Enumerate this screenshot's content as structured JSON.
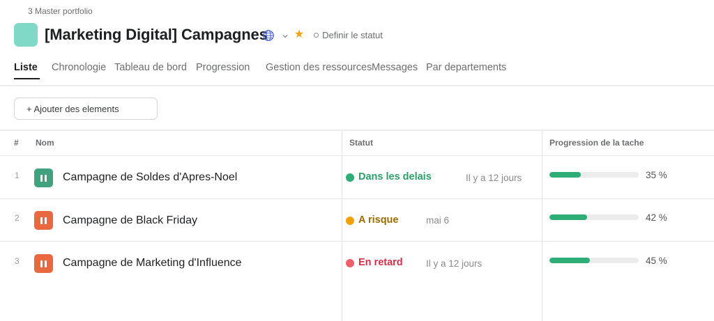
{
  "breadcrumb": "3 Master portfolio",
  "project": {
    "title": "[Marketing Digital] Campagnes",
    "status_prompt": "Definir le statut",
    "color": "#7fd9c6"
  },
  "icons": {
    "globe": "globe-icon",
    "chevron": "chevron-down-icon",
    "star": "star-icon",
    "status_circle": "circle-icon",
    "row_status": "pause-icon"
  },
  "tabs": [
    {
      "label": "Liste",
      "active": true
    },
    {
      "label": "Chronologie",
      "active": false
    },
    {
      "label": "Tableau de bord",
      "active": false
    },
    {
      "label": "Progression",
      "active": false
    },
    {
      "label": "Gestion des ressources",
      "active": false
    },
    {
      "label": "Messages",
      "active": false
    },
    {
      "label": "Par departements",
      "active": false
    }
  ],
  "toolbar": {
    "add_label": "+ Ajouter des elements"
  },
  "table": {
    "headers": {
      "num": "#",
      "name": "Nom",
      "status": "Statut",
      "progress": "Progression de la tache"
    },
    "rows": [
      {
        "num": "1",
        "name": "Campagne de Soldes d'Apres-Noel",
        "icon_color": "#3fa37f",
        "status": "Dans les delais",
        "status_color": "#2f9e6a",
        "dot_color": "#2fad77",
        "updated": "Il y a 12 jours",
        "progress": 0.35,
        "progress_label": "35 %"
      },
      {
        "num": "2",
        "name": "Campagne de Black Friday",
        "icon_color": "#e8693f",
        "status": "A risque",
        "status_color": "#9a6c00",
        "dot_color": "#f1a20b",
        "updated": "mai 6",
        "progress": 0.42,
        "progress_label": "42 %"
      },
      {
        "num": "3",
        "name": "Campagne de Marketing d'Influence",
        "icon_color": "#e8693f",
        "status": "En retard",
        "status_color": "#d1324a",
        "dot_color": "#ef5f6b",
        "updated": "Il y a 12 jours",
        "progress": 0.45,
        "progress_label": "45 %"
      }
    ]
  }
}
